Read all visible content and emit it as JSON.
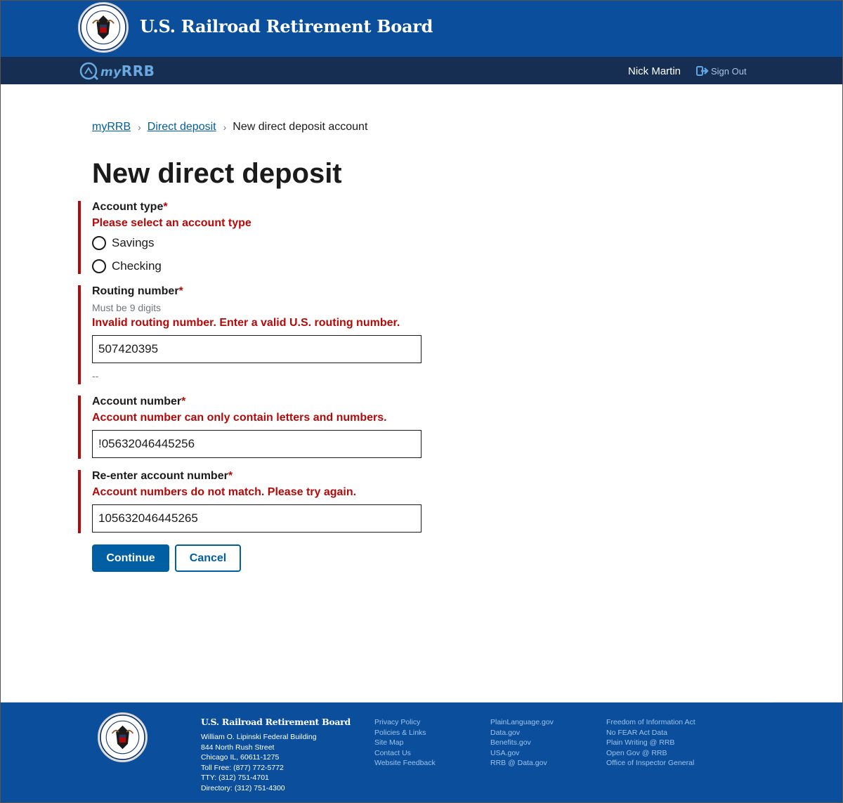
{
  "header": {
    "agency_title": "U.S. Railroad Retirement Board"
  },
  "nav": {
    "logo_prefix": "my",
    "logo_suffix": "RRB",
    "user_name": "Nick Martin",
    "sign_out": "Sign Out"
  },
  "breadcrumb": {
    "items": [
      {
        "label": "myRRB"
      },
      {
        "label": "Direct deposit"
      }
    ],
    "current": "New direct deposit account"
  },
  "page_title": "New direct deposit",
  "form": {
    "required_marker": "*",
    "account_type": {
      "label": "Account type",
      "error": "Please select an account type",
      "options": [
        "Savings",
        "Checking"
      ]
    },
    "routing_number": {
      "label": "Routing number",
      "hint": "Must be 9 digits",
      "error": "Invalid routing number. Enter a valid U.S. routing number.",
      "value": "507420395",
      "bank_name": "--"
    },
    "account_number": {
      "label": "Account number",
      "error": "Account number can only contain letters and numbers.",
      "value": "!05632046445256"
    },
    "reenter_account_number": {
      "label": "Re-enter account number",
      "error": "Account numbers do not match. Please try again.",
      "value": "105632046445265"
    }
  },
  "buttons": {
    "continue": "Continue",
    "cancel": "Cancel"
  },
  "footer": {
    "agency_title": "U.S. Railroad Retirement Board",
    "address_lines": [
      "William O. Lipinski Federal Building",
      "844 North Rush Street",
      "Chicago IL, 60611-1275",
      "Toll Free: (877) 772-5772",
      "TTY: (312) 751-4701",
      "Directory: (312) 751-4300"
    ],
    "links_col1": [
      "Privacy Policy",
      "Policies & Links",
      "Site Map",
      "Contact Us",
      "Website Feedback"
    ],
    "links_col2": [
      "PlainLanguage.gov",
      "Data.gov",
      "Benefits.gov",
      "USA.gov",
      "RRB @ Data.gov"
    ],
    "links_col3": [
      "Freedom of Information Act",
      "No FEAR Act Data",
      "Plain Writing @ RRB",
      "Open Gov @ RRB",
      "Office of Inspector General"
    ]
  },
  "colors": {
    "header_blue": "#0b4f9c",
    "nav_navy": "#162e51",
    "error_red": "#b50909",
    "primary_button": "#005ea2"
  }
}
